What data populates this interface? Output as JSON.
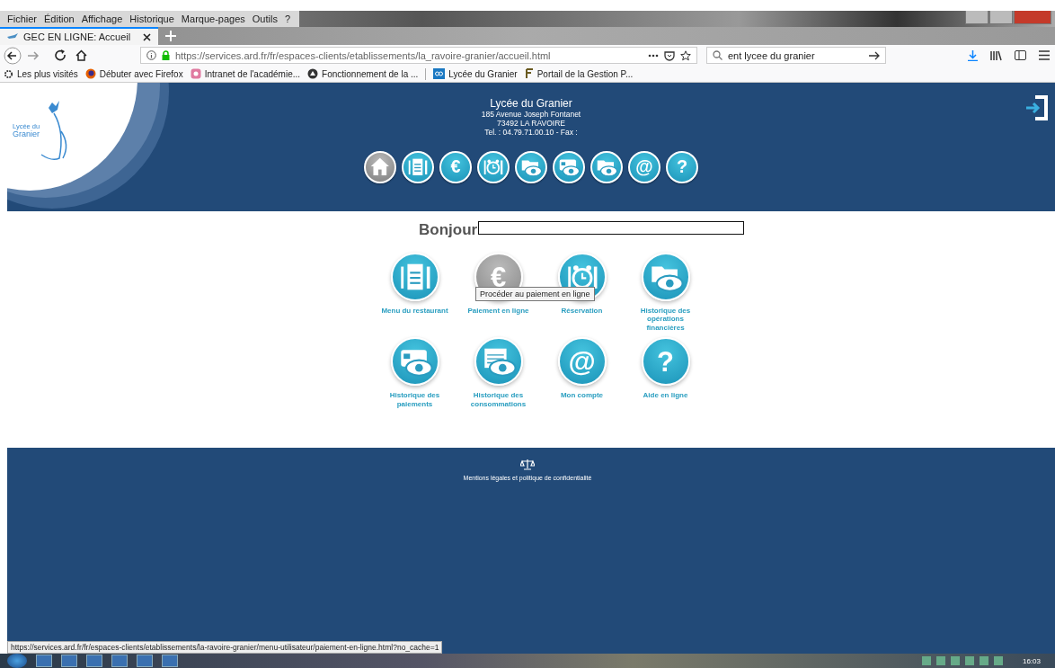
{
  "browser": {
    "menu": [
      "Fichier",
      "Édition",
      "Affichage",
      "Historique",
      "Marque-pages",
      "Outils",
      "?"
    ],
    "tabs": [
      {
        "title": "GEC EN LIGNE: Accueil",
        "selected": true
      }
    ],
    "address": {
      "url": "https://services.ard.fr/fr/espaces-clients/etablissements/la_ravoire-granier/accueil.html"
    },
    "search": {
      "value": "ent lycee du granier"
    },
    "bookmarks": [
      {
        "kind": "gear",
        "label": "Les plus visités"
      },
      {
        "kind": "firefox",
        "label": "Débuter avec Firefox"
      },
      {
        "kind": "intranet",
        "label": "Intranet de l'académie..."
      },
      {
        "kind": "dark",
        "label": "Fonctionnement de la ..."
      },
      {
        "kind": "lycee",
        "label": "Lycée du Granier"
      },
      {
        "kind": "portail",
        "label": "Portail de la Gestion P..."
      }
    ]
  },
  "school": {
    "logo_lines": [
      "Lycée du",
      "Granier"
    ],
    "name": "Lycée du Granier",
    "address_lines": [
      "185 Avenue Joseph Fontanet",
      "73492 LA RAVOIRE",
      "Tel. : 04.79.71.00.10 - Fax :"
    ]
  },
  "nav": [
    {
      "kind": "home",
      "selected": true
    },
    {
      "kind": "menu",
      "selected": false
    },
    {
      "kind": "euro",
      "glyph": "€",
      "selected": false
    },
    {
      "kind": "reservation",
      "selected": false
    },
    {
      "kind": "eye-folder",
      "selected": false
    },
    {
      "kind": "eye-card",
      "selected": false
    },
    {
      "kind": "eye-folder",
      "selected": false
    },
    {
      "kind": "account",
      "glyph": "@",
      "selected": false
    },
    {
      "kind": "help",
      "glyph": "?",
      "selected": false
    }
  ],
  "greeting": "Bonjour",
  "tiles": [
    {
      "kind": "menu",
      "label": "Menu du restaurant",
      "hovered": false
    },
    {
      "kind": "euro",
      "glyph": "€",
      "label": "Paiement en ligne",
      "hovered": true
    },
    {
      "kind": "reservation",
      "label": "Réservation",
      "hovered": false
    },
    {
      "kind": "eye-folder",
      "label": "Historique des opérations financières",
      "hovered": false
    },
    {
      "kind": "eye-card",
      "label": "Historique des paiements",
      "hovered": false
    },
    {
      "kind": "eye-calendar",
      "label": "Historique des consommations",
      "hovered": false
    },
    {
      "kind": "account",
      "glyph": "@",
      "label": "Mon compte",
      "hovered": false
    },
    {
      "kind": "help",
      "glyph": "?",
      "label": "Aide en ligne",
      "hovered": false
    }
  ],
  "tooltip": "Procéder au paiement en ligne",
  "footer": {
    "link": "Mentions légales et politique de confidentialité"
  },
  "status_url": "https://services.ard.fr/fr/espaces-clients/etablissements/la-ravoire-granier/menu-utilisateur/paiement-en-ligne.html?no_cache=1",
  "taskbar": {
    "clock": "16:03"
  }
}
